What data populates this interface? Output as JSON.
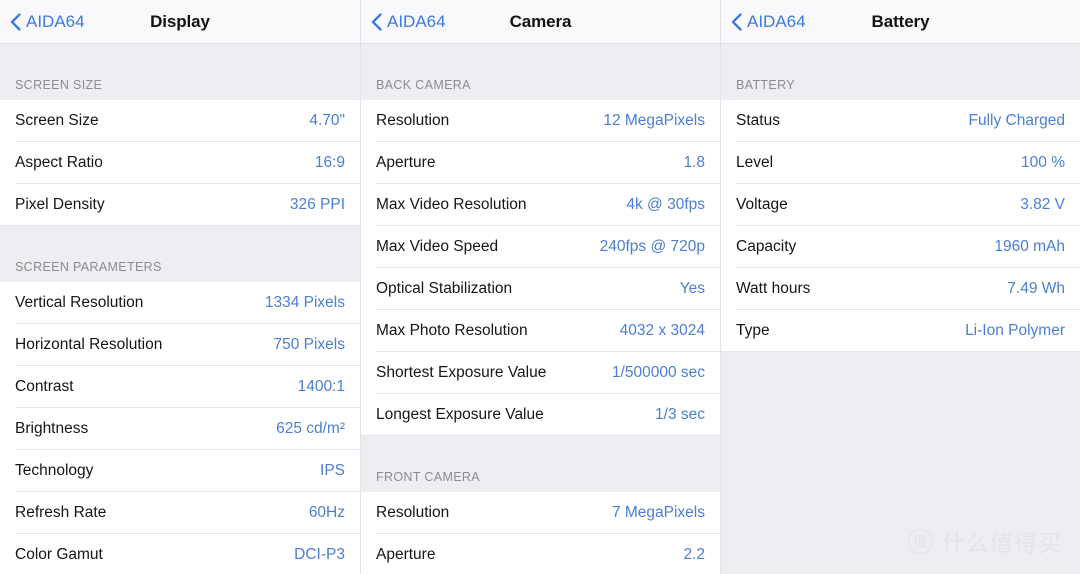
{
  "panels": [
    {
      "back_label": "AIDA64",
      "title": "Display",
      "sections": [
        {
          "header": "SCREEN SIZE",
          "rows": [
            {
              "label": "Screen Size",
              "value": "4.70\""
            },
            {
              "label": "Aspect Ratio",
              "value": "16:9"
            },
            {
              "label": "Pixel Density",
              "value": "326 PPI"
            }
          ]
        },
        {
          "header": "SCREEN PARAMETERS",
          "rows": [
            {
              "label": "Vertical Resolution",
              "value": "1334 Pixels"
            },
            {
              "label": "Horizontal Resolution",
              "value": "750 Pixels"
            },
            {
              "label": "Contrast",
              "value": "1400:1"
            },
            {
              "label": "Brightness",
              "value": "625 cd/m²"
            },
            {
              "label": "Technology",
              "value": "IPS"
            },
            {
              "label": "Refresh Rate",
              "value": "60Hz"
            },
            {
              "label": "Color Gamut",
              "value": "DCI-P3"
            }
          ]
        }
      ]
    },
    {
      "back_label": "AIDA64",
      "title": "Camera",
      "sections": [
        {
          "header": "BACK CAMERA",
          "rows": [
            {
              "label": "Resolution",
              "value": "12 MegaPixels"
            },
            {
              "label": "Aperture",
              "value": "1.8"
            },
            {
              "label": "Max Video Resolution",
              "value": "4k @ 30fps"
            },
            {
              "label": "Max Video Speed",
              "value": "240fps @ 720p"
            },
            {
              "label": "Optical Stabilization",
              "value": "Yes"
            },
            {
              "label": "Max Photo Resolution",
              "value": "4032 x 3024"
            },
            {
              "label": "Shortest Exposure Value",
              "value": "1/500000 sec"
            },
            {
              "label": "Longest Exposure Value",
              "value": "1/3 sec"
            }
          ]
        },
        {
          "header": "FRONT CAMERA",
          "rows": [
            {
              "label": "Resolution",
              "value": "7 MegaPixels"
            },
            {
              "label": "Aperture",
              "value": "2.2"
            }
          ]
        }
      ]
    },
    {
      "back_label": "AIDA64",
      "title": "Battery",
      "sections": [
        {
          "header": "BATTERY",
          "rows": [
            {
              "label": "Status",
              "value": "Fully Charged"
            },
            {
              "label": "Level",
              "value": "100 %"
            },
            {
              "label": "Voltage",
              "value": "3.82 V"
            },
            {
              "label": "Capacity",
              "value": "1960 mAh"
            },
            {
              "label": "Watt hours",
              "value": "7.49 Wh"
            },
            {
              "label": "Type",
              "value": "Li-Ion Polymer"
            }
          ]
        }
      ]
    }
  ],
  "watermark": {
    "badge": "值",
    "text": "什么值得买"
  },
  "colors": {
    "accent_blue": "#4a7fd4",
    "nav_blue": "#3b7ae0",
    "background_grey": "#eeeef2",
    "row_white": "#ffffff",
    "separator": "#e6e6ea",
    "section_text": "#8b8b90"
  }
}
